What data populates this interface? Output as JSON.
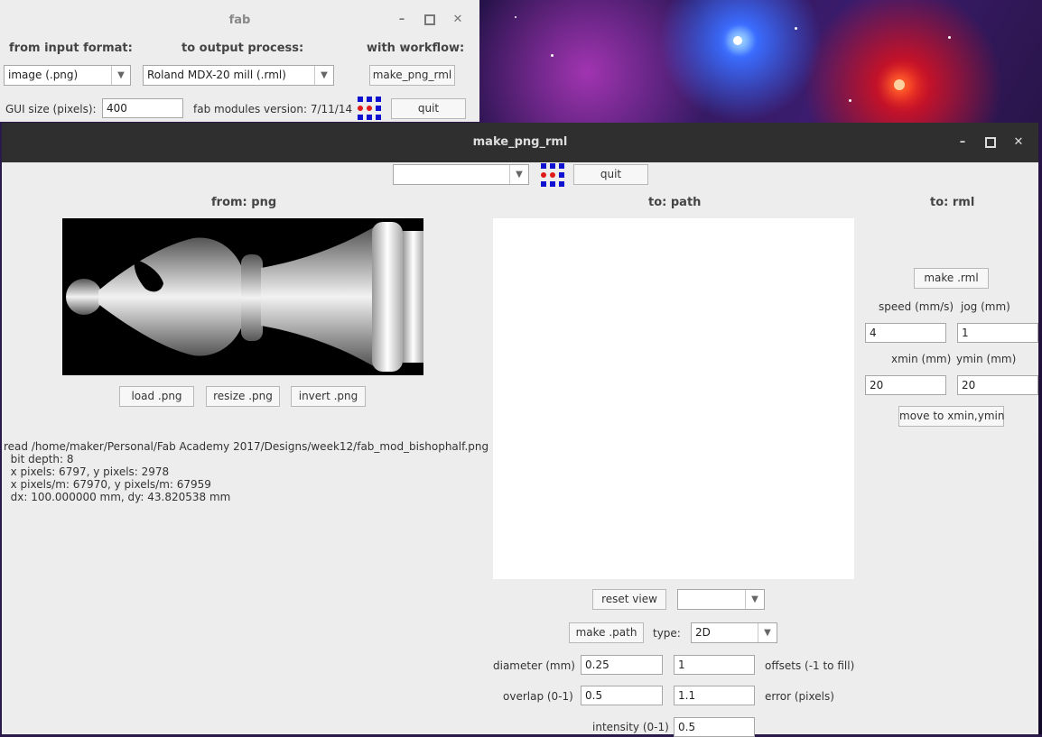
{
  "fab_window": {
    "title": "fab",
    "from_label": "from input format:",
    "to_label": "to output process:",
    "workflow_label": "with workflow:",
    "input_format": "image (.png)",
    "output_process": "Roland MDX-20 mill (.rml)",
    "workflow_button": "make_png_rml",
    "gui_size_label": "GUI size (pixels):",
    "gui_size_value": "400",
    "version_text": "fab modules version: 7/11/14",
    "quit_label": "quit"
  },
  "main_window": {
    "title": "make_png_rml",
    "top_select": "",
    "quit_label": "quit",
    "from_header": "from: png",
    "path_header": "to: path",
    "rml_header": "to: rml",
    "load_button": "load .png",
    "resize_button": "resize .png",
    "invert_button": "invert .png",
    "log_lines": [
      "read /home/maker/Personal/Fab Academy 2017/Designs/week12/fab_mod_bishophalf.png",
      "  bit depth: 8",
      "  x pixels: 6797, y pixels: 2978",
      "  x pixels/m: 67970, y pixels/m: 67959",
      "  dx: 100.000000 mm, dy: 43.820538 mm"
    ],
    "reset_view_button": "reset view",
    "view_select": "",
    "make_path_button": "make .path",
    "type_label": "type:",
    "type_value": "2D",
    "diameter_label": "diameter (mm)",
    "diameter_value": "0.25",
    "offsets_value": "1",
    "offsets_label": "offsets (-1 to fill)",
    "overlap_label": "overlap (0-1)",
    "overlap_value": "0.5",
    "error_value": "1.1",
    "error_label": "error (pixels)",
    "intensity_label": "intensity (0-1)",
    "intensity_value": "0.5",
    "make_rml_button": "make .rml",
    "speed_label": "speed (mm/s)",
    "jog_label": "jog (mm)",
    "speed_value": "4",
    "jog_value": "1",
    "xmin_label": "xmin (mm)",
    "ymin_label": "ymin (mm)",
    "xmin_value": "20",
    "ymin_value": "20",
    "move_button": "move to xmin,ymin"
  }
}
